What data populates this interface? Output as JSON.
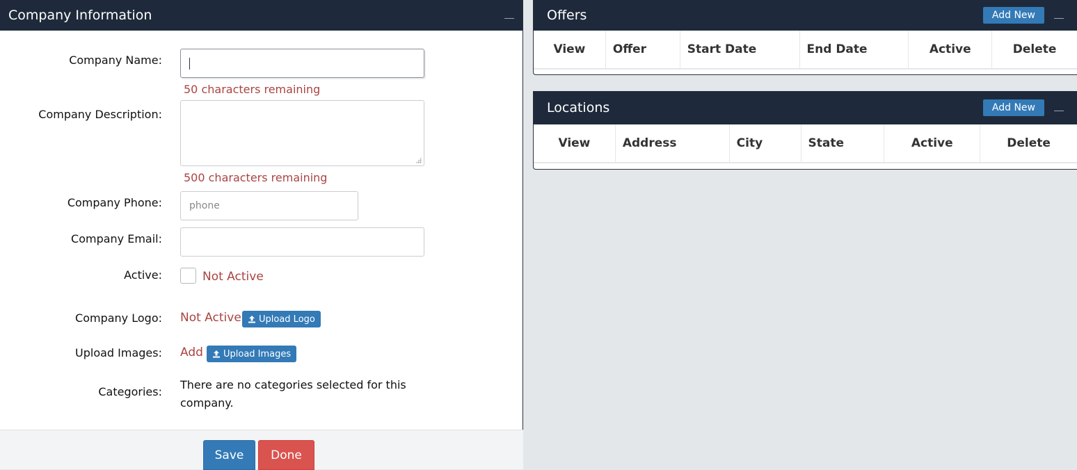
{
  "company_panel": {
    "title": "Company Information",
    "labels": {
      "name": "Company Name:",
      "description": "Company Description:",
      "phone": "Company Phone:",
      "email": "Company Email:",
      "active": "Active:",
      "logo": "Company Logo:",
      "images": "Upload Images:",
      "categories": "Categories:"
    },
    "name_remaining": "50 characters remaining",
    "description_remaining": "500 characters remaining",
    "phone_placeholder": "phone",
    "active_status": "Not Active",
    "logo_status": "Not Active",
    "upload_logo_label": "Upload Logo",
    "images_status": "Add",
    "upload_images_label": "Upload Images",
    "categories_text": "There are no categories selected for this company.",
    "save_label": "Save",
    "done_label": "Done"
  },
  "offers_panel": {
    "title": "Offers",
    "add_label": "Add New",
    "columns": [
      "View",
      "Offer",
      "Start Date",
      "End Date",
      "Active",
      "Delete"
    ]
  },
  "locations_panel": {
    "title": "Locations",
    "add_label": "Add New",
    "columns": [
      "View",
      "Address",
      "City",
      "State",
      "Active",
      "Delete"
    ]
  },
  "colors": {
    "header_bg": "#1e2a3b",
    "primary": "#337ab7",
    "danger": "#d9534f",
    "warning_text": "#a94442"
  }
}
